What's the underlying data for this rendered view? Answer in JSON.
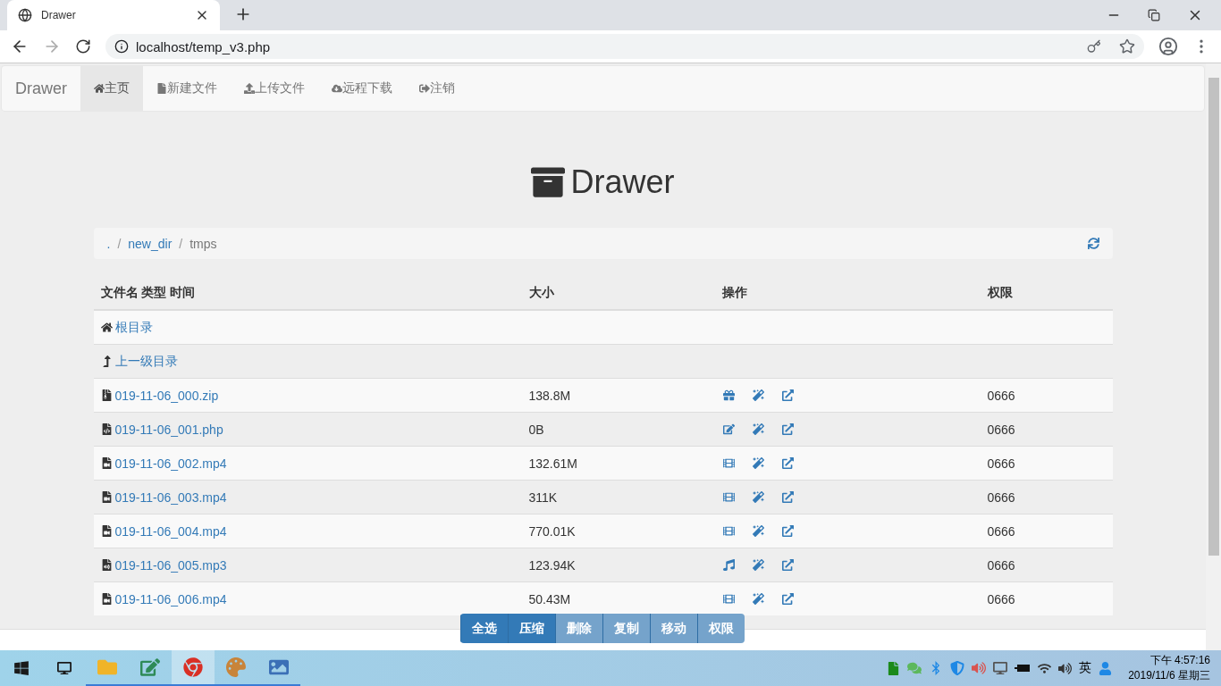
{
  "browser": {
    "tab_title": "Drawer",
    "url": "localhost/temp_v3.php"
  },
  "navbar": {
    "brand": "Drawer",
    "items": [
      {
        "label": "主页",
        "selected": true
      },
      {
        "label": "新建文件",
        "selected": false
      },
      {
        "label": "上传文件",
        "selected": false
      },
      {
        "label": "远程下载",
        "selected": false
      },
      {
        "label": "注销",
        "selected": false
      }
    ]
  },
  "header": {
    "title": "Drawer"
  },
  "breadcrumb": [
    {
      "label": ".",
      "current": false
    },
    {
      "separator": "/",
      "label": "new_dir",
      "current": false
    },
    {
      "separator": "/",
      "label": "tmps",
      "current": true
    }
  ],
  "table": {
    "columns": [
      "文件名 类型 时间",
      "大小",
      "操作",
      "权限"
    ],
    "nav_rows": [
      {
        "kind": "root",
        "label": "根目录"
      },
      {
        "kind": "parent",
        "label": "上一级目录"
      }
    ],
    "rows": [
      {
        "kind": "zip",
        "name": "019-11-06_000.zip",
        "size": "138.8M",
        "permission": "0666"
      },
      {
        "kind": "php",
        "name": "019-11-06_001.php",
        "size": "0B",
        "permission": "0666"
      },
      {
        "kind": "video",
        "name": "019-11-06_002.mp4",
        "size": "132.61M",
        "permission": "0666"
      },
      {
        "kind": "video",
        "name": "019-11-06_003.mp4",
        "size": "311K",
        "permission": "0666"
      },
      {
        "kind": "video",
        "name": "019-11-06_004.mp4",
        "size": "770.01K",
        "permission": "0666"
      },
      {
        "kind": "audio",
        "name": "019-11-06_005.mp3",
        "size": "123.94K",
        "permission": "0666"
      },
      {
        "kind": "video",
        "name": "019-11-06_006.mp4",
        "size": "50.43M",
        "permission": "0666"
      }
    ]
  },
  "actions": [
    {
      "label": "全选",
      "disabled": false
    },
    {
      "label": "压缩",
      "disabled": false
    },
    {
      "label": "删除",
      "disabled": true
    },
    {
      "label": "复制",
      "disabled": true
    },
    {
      "label": "移动",
      "disabled": true
    },
    {
      "label": "权限",
      "disabled": true
    }
  ],
  "taskbar": {
    "apps": [
      {
        "kind": "explorer",
        "selected": false
      },
      {
        "kind": "editor",
        "selected": false
      },
      {
        "kind": "chrome",
        "selected": true
      },
      {
        "kind": "paint",
        "selected": false
      },
      {
        "kind": "photos",
        "selected": false
      }
    ],
    "ime": "英",
    "time": "下午 4:57:16",
    "date": "2019/11/6 星期三"
  }
}
